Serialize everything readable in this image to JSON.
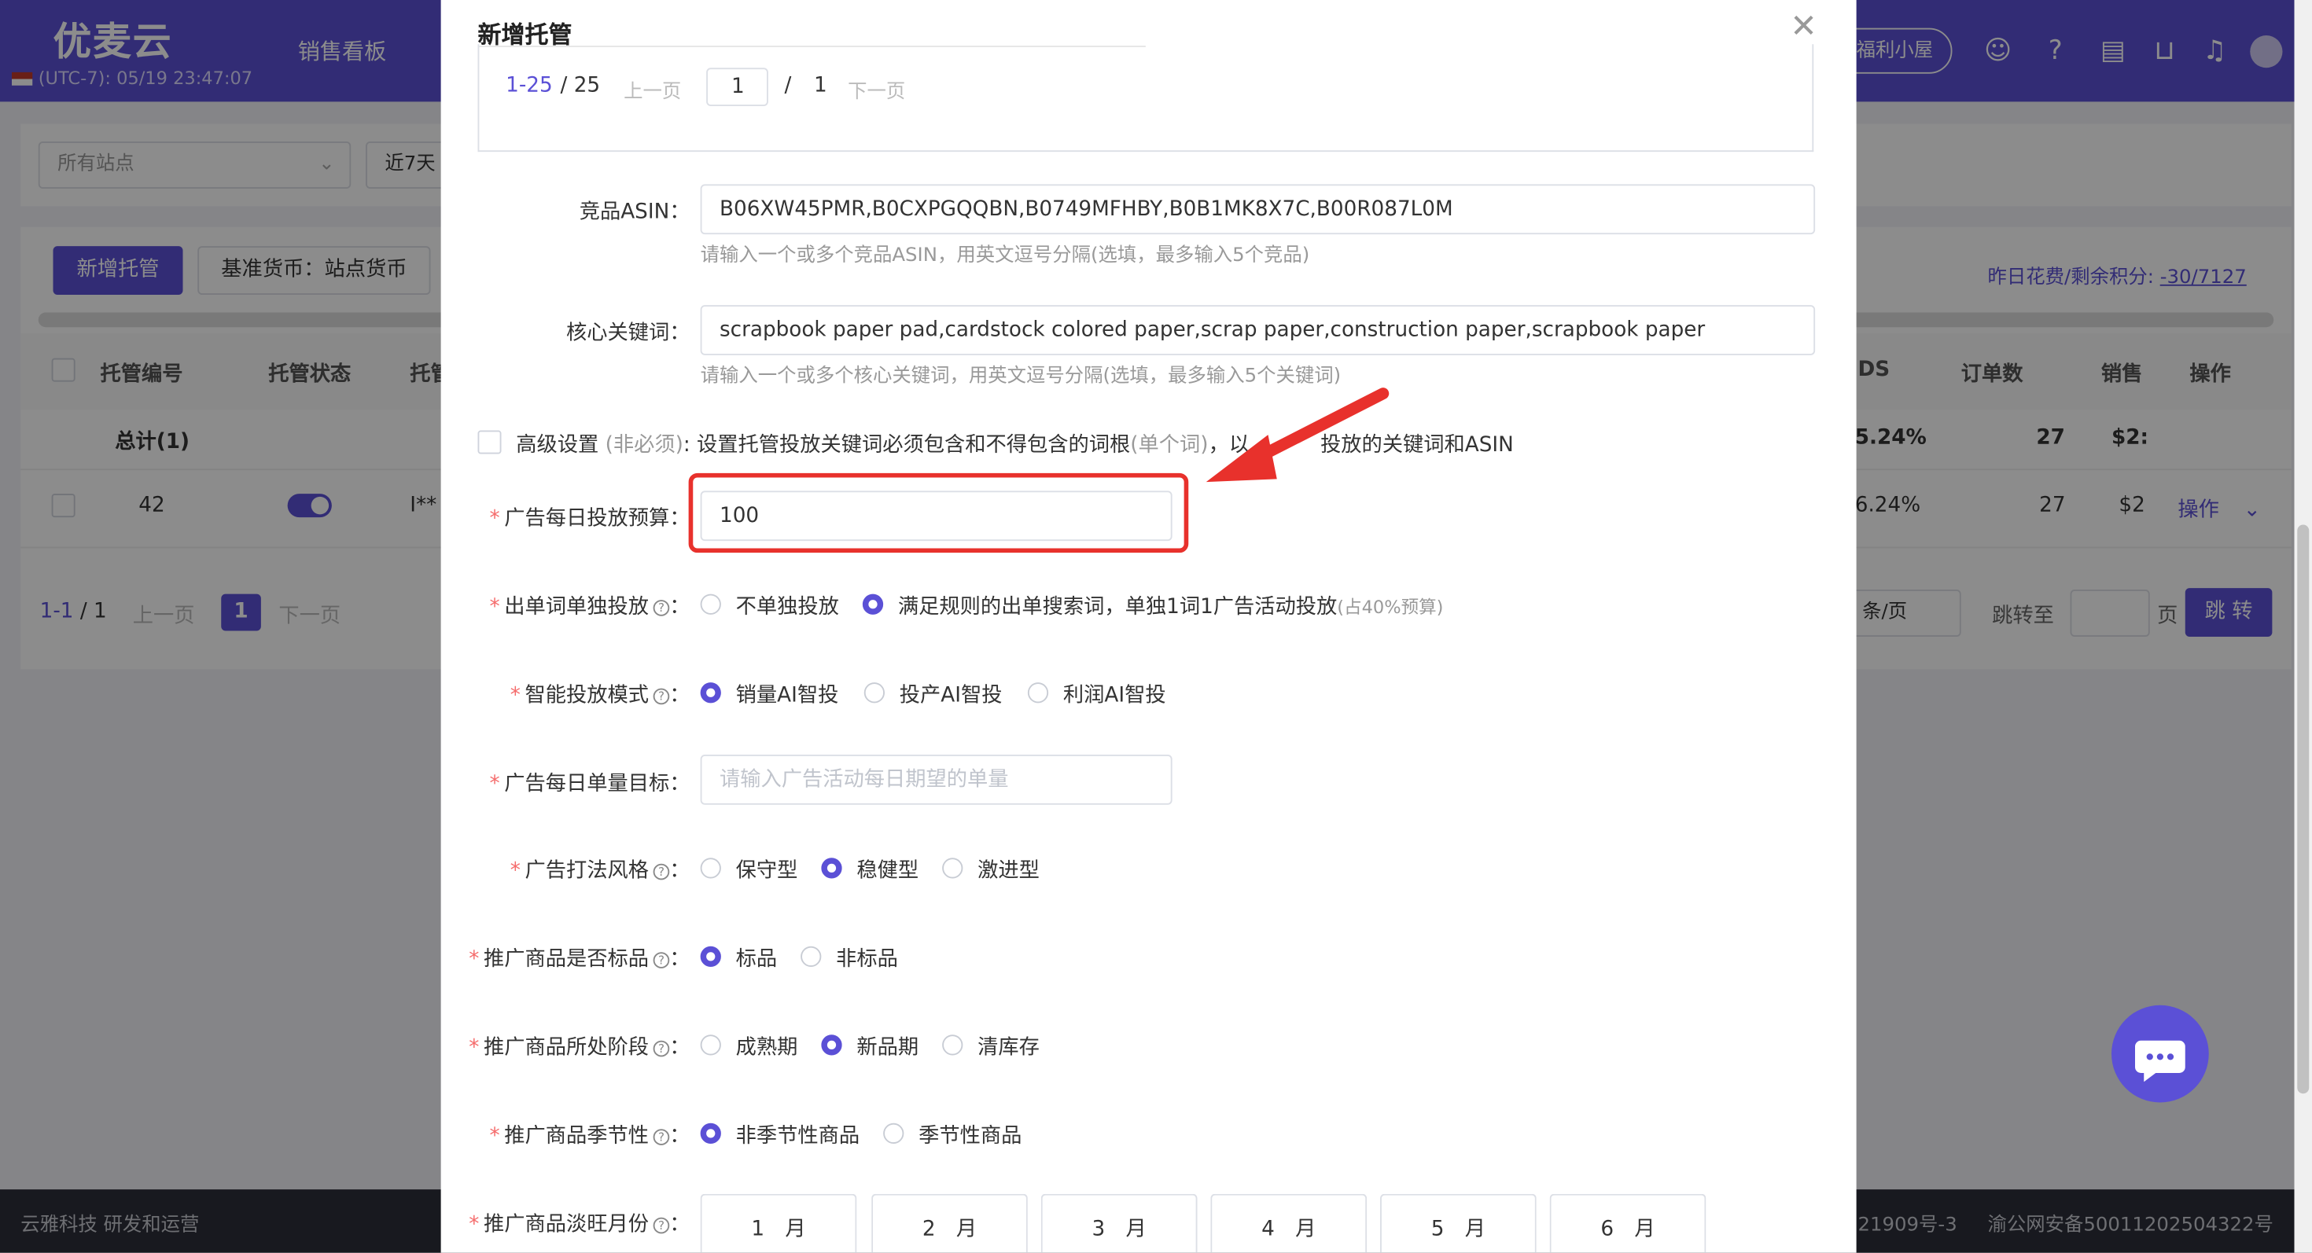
{
  "app": {
    "logo": "优麦云",
    "nav_sales_board": "销售看板",
    "timezone": "(UTC-7): 05/19 23:47:07",
    "welfare": "福利小屋",
    "icons": [
      "support-icon",
      "help-icon",
      "message-icon",
      "cart-icon",
      "bell-icon",
      "avatar-icon"
    ]
  },
  "filters": {
    "site_placeholder": "所有站点",
    "period": "近7天"
  },
  "toolbar": {
    "add_button": "新增托管",
    "currency_button": "基准货币：站点货币",
    "spend_label": "昨日花费/剩余积分:",
    "spend_value": "-30/7127"
  },
  "table": {
    "headers": [
      "托管编号",
      "托管状态",
      "托管",
      "DS",
      "订单数",
      "销售",
      "操作"
    ],
    "total_row": {
      "label": "总计(1)",
      "acos": "5.24%",
      "orders": "27",
      "sales": "$2:"
    },
    "rows": [
      {
        "id": "42",
        "name": "I**",
        "acos": "6.24%",
        "orders": "27",
        "sales": "$2",
        "action": "操作"
      }
    ]
  },
  "pager": {
    "range": "1-1",
    "total": "/ 1",
    "prev": "上一页",
    "current": "1",
    "next": "下一页",
    "per_page": "条/页",
    "goto_label": "跳转至",
    "page_unit": "页",
    "goto_button": "跳 转"
  },
  "footer": {
    "left": "云雅科技 研发和运营",
    "icp": "21909号-3",
    "police": "渝公网安备50011202504322号"
  },
  "modal": {
    "title": "新增托管",
    "inner_pager": {
      "range": "1-25",
      "total": "/ 25",
      "prev": "上一页",
      "page_value": "1",
      "slash": "/",
      "pages": "1",
      "next": "下一页"
    },
    "competitor_asin": {
      "label": "竞品ASIN：",
      "value": "B06XW45PMR,B0CXPGQQBN,B0749MFHBY,B0B1MK8X7C,B00R087L0M",
      "hint": "请输入一个或多个竞品ASIN，用英文逗号分隔(选填，最多输入5个竞品)"
    },
    "core_keywords": {
      "label": "核心关键词：",
      "value": "scrapbook paper pad,cardstock colored paper,scrap paper,construction paper,scrapbook paper",
      "hint": "请输入一个或多个核心关键词，用英文逗号分隔(选填，最多输入5个关键词)"
    },
    "advanced": {
      "label": "高级设置",
      "optional": "(非必须)",
      "text1": ": 设置托管投放关键词必须包含和不得包含的词根",
      "unit": "(单个词)",
      "text2": "，以",
      "text3": "投放的关键词和ASIN"
    },
    "daily_budget": {
      "label": "广告每日投放预算：",
      "value": "100"
    },
    "single_word": {
      "label": "出单词单独投放",
      "options": [
        "不单独投放",
        "满足规则的出单搜索词，单独1词1广告活动投放"
      ],
      "note": "(占40%预算)",
      "selected": 1
    },
    "smart_mode": {
      "label": "智能投放模式",
      "options": [
        "销量AI智投",
        "投产AI智投",
        "利润AI智投"
      ],
      "selected": 0
    },
    "daily_orders": {
      "label": "广告每日单量目标：",
      "placeholder": "请输入广告活动每日期望的单量"
    },
    "ad_style": {
      "label": "广告打法风格",
      "options": [
        "保守型",
        "稳健型",
        "激进型"
      ],
      "selected": 1
    },
    "standard": {
      "label": "推广商品是否标品",
      "options": [
        "标品",
        "非标品"
      ],
      "selected": 0
    },
    "stage": {
      "label": "推广商品所处阶段",
      "options": [
        "成熟期",
        "新品期",
        "清库存"
      ],
      "selected": 1
    },
    "seasonal": {
      "label": "推广商品季节性",
      "options": [
        "非季节性商品",
        "季节性商品"
      ],
      "selected": 0
    },
    "off_months": {
      "label": "推广商品淡旺月份",
      "months": [
        "1　月",
        "2　月",
        "3　月",
        "4　月",
        "5　月",
        "6　月"
      ]
    }
  },
  "colors": {
    "primary": "#5b50d6",
    "annotation": "#e8312c",
    "required": "#f56c6c"
  }
}
